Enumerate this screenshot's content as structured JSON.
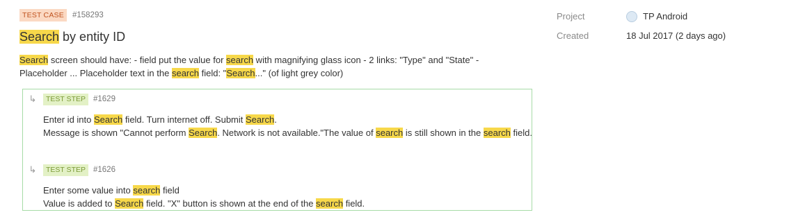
{
  "entity": {
    "type_badge": "TEST CASE",
    "id": "#158293",
    "title_hl": "Search",
    "title_rest": " by entity ID",
    "description": [
      {
        "t": "Search",
        "h": true
      },
      {
        "t": " screen should have: - field put the value for ",
        "h": false
      },
      {
        "t": "search",
        "h": true
      },
      {
        "t": " with magnifying glass icon - 2 links: \"Type\" and \"State\" - Placeholder ... Placeholder text in the ",
        "h": false
      },
      {
        "t": "search",
        "h": true
      },
      {
        "t": " field: \"",
        "h": false
      },
      {
        "t": "Search",
        "h": true
      },
      {
        "t": "...\" (of light grey color)",
        "h": false
      }
    ]
  },
  "steps": [
    {
      "badge": "TEST STEP",
      "id": "#1629",
      "lines": [
        [
          {
            "t": "Enter id into ",
            "h": false
          },
          {
            "t": "Search",
            "h": true
          },
          {
            "t": " field. Turn internet off. Submit ",
            "h": false
          },
          {
            "t": "Search",
            "h": true
          },
          {
            "t": ".",
            "h": false
          }
        ],
        [
          {
            "t": "Message is shown \"Cannot perform ",
            "h": false
          },
          {
            "t": "Search",
            "h": true
          },
          {
            "t": ". Network is not available.\"The value of ",
            "h": false
          },
          {
            "t": "search",
            "h": true
          },
          {
            "t": " is still shown in the ",
            "h": false
          },
          {
            "t": "search",
            "h": true
          },
          {
            "t": " field.",
            "h": false
          }
        ]
      ]
    },
    {
      "badge": "TEST STEP",
      "id": "#1626",
      "lines": [
        [
          {
            "t": "Enter some value into ",
            "h": false
          },
          {
            "t": "search",
            "h": true
          },
          {
            "t": " field",
            "h": false
          }
        ],
        [
          {
            "t": "Value is added to ",
            "h": false
          },
          {
            "t": "Search",
            "h": true
          },
          {
            "t": " field. \"X\" button is shown at the end of the ",
            "h": false
          },
          {
            "t": "search",
            "h": true
          },
          {
            "t": " field.",
            "h": false
          }
        ]
      ]
    }
  ],
  "meta": {
    "project_label": "Project",
    "project_value": "TP Android",
    "created_label": "Created",
    "created_value": "18 Jul 2017 (2 days ago)"
  },
  "icons": {
    "step_arrow": "↳",
    "project": "project-icon"
  },
  "colors": {
    "highlight": "#f7d84a",
    "case_badge_bg": "#fbd9c3",
    "step_badge_bg": "#e3f1c6",
    "steps_border": "#a6dca6"
  }
}
